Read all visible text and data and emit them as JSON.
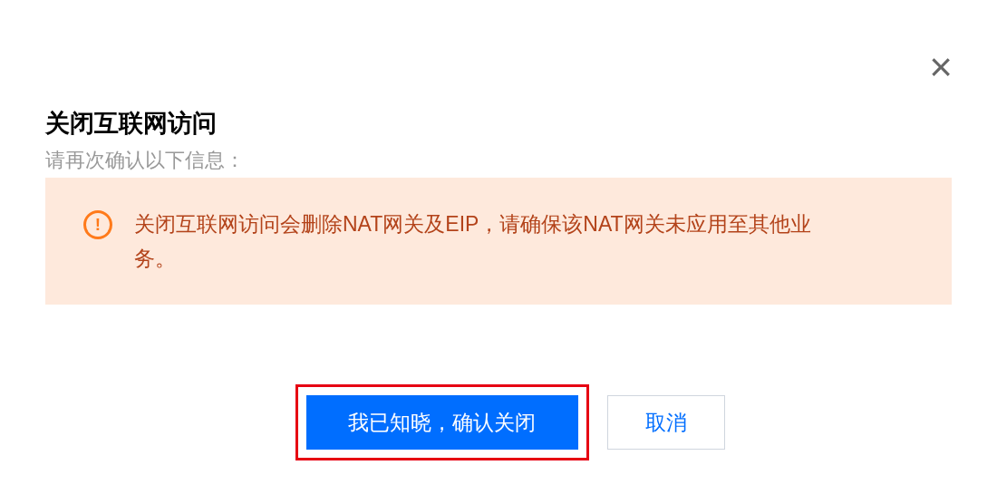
{
  "dialog": {
    "close": "×",
    "title": "关闭互联网访问",
    "subtitle": "请再次确认以下信息：",
    "alert": {
      "icon": "!",
      "message": "关闭互联网访问会删除NAT网关及EIP，请确保该NAT网关未应用至其他业务。"
    },
    "buttons": [
      {
        "kind": "primary",
        "label": "我已知晓，确认关闭",
        "highlighted": true
      },
      {
        "kind": "secondary",
        "label": "取消",
        "highlighted": false
      }
    ]
  }
}
